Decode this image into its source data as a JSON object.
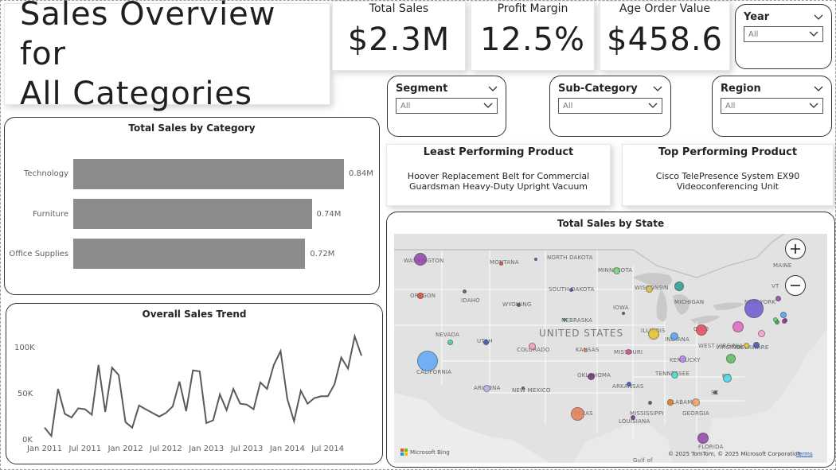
{
  "title": {
    "line1": "Sales Overview for",
    "line2": "All Categories"
  },
  "kpis": [
    {
      "label": "Total Sales",
      "value": "$2.3M"
    },
    {
      "label": "Profit Margin",
      "value": "12.5%"
    },
    {
      "label": "Age Order Value",
      "value": "$458.6"
    }
  ],
  "slicers": {
    "year": {
      "label": "Year",
      "value": "All"
    },
    "segment": {
      "label": "Segment",
      "value": "All"
    },
    "subcategory": {
      "label": "Sub-Category",
      "value": "All"
    },
    "region": {
      "label": "Region",
      "value": "All"
    }
  },
  "least_product": {
    "title": "Least Performing Product",
    "name": "Hoover Replacement Belt for Commercial Guardsman Heavy-Duty Upright Vacuum"
  },
  "top_product": {
    "title": "Top Performing Product",
    "name": "Cisco TelePresence System EX90 Videoconferencing Unit"
  },
  "category_chart": {
    "title": "Total Sales by Category",
    "bars": [
      {
        "category": "Technology",
        "label": "0.84M"
      },
      {
        "category": "Furniture",
        "label": "0.74M"
      },
      {
        "category": "Office Supplies",
        "label": "0.72M"
      }
    ]
  },
  "trend_chart": {
    "title": "Overall Sales Trend",
    "y_ticks": [
      "100K",
      "50K",
      "0K"
    ],
    "x_ticks": [
      "Jan 2011",
      "Jul 2011",
      "Jan 2012",
      "Jul 2012",
      "Jan 2013",
      "Jul 2013",
      "Jan 2014",
      "Jul 2014"
    ]
  },
  "chart_data": [
    {
      "type": "bar",
      "title": "Total Sales by Category",
      "categories": [
        "Technology",
        "Furniture",
        "Office Supplies"
      ],
      "values": [
        0.84,
        0.74,
        0.72
      ],
      "unit": "M",
      "orientation": "horizontal"
    },
    {
      "type": "line",
      "title": "Overall Sales Trend",
      "x": [
        "2011-01",
        "2011-02",
        "2011-03",
        "2011-04",
        "2011-05",
        "2011-06",
        "2011-07",
        "2011-08",
        "2011-09",
        "2011-10",
        "2011-11",
        "2011-12",
        "2012-01",
        "2012-02",
        "2012-03",
        "2012-04",
        "2012-05",
        "2012-06",
        "2012-07",
        "2012-08",
        "2012-09",
        "2012-10",
        "2012-11",
        "2012-12",
        "2013-01",
        "2013-02",
        "2013-03",
        "2013-04",
        "2013-05",
        "2013-06",
        "2013-07",
        "2013-08",
        "2013-09",
        "2013-10",
        "2013-11",
        "2013-12",
        "2014-01",
        "2014-02",
        "2014-03",
        "2014-04",
        "2014-05",
        "2014-06",
        "2014-07",
        "2014-08",
        "2014-09",
        "2014-10",
        "2014-11",
        "2014-12"
      ],
      "values": [
        14000,
        5000,
        56000,
        29000,
        25000,
        35000,
        34000,
        28000,
        82000,
        31000,
        79000,
        71000,
        20000,
        14000,
        38000,
        34000,
        30000,
        26000,
        30000,
        37000,
        64000,
        32000,
        76000,
        75000,
        19000,
        22000,
        50000,
        33000,
        56000,
        40000,
        39000,
        34000,
        63000,
        56000,
        82000,
        97000,
        45000,
        21000,
        54000,
        40000,
        46000,
        48000,
        48000,
        61000,
        90000,
        78000,
        113000,
        92000
      ],
      "ylim": [
        0,
        120000
      ],
      "y_ticks": [
        "100K",
        "50K",
        "0K"
      ],
      "x_ticks": [
        "Jan 2011",
        "Jul 2011",
        "Jan 2012",
        "Jul 2012",
        "Jan 2013",
        "Jul 2013",
        "Jan 2014",
        "Jul 2014"
      ],
      "color": "#5a5a5a"
    }
  ],
  "map": {
    "title": "Total Sales by State",
    "country_label": "UNITED STATES",
    "state_labels": [
      {
        "name": "WASHINGTON"
      },
      {
        "name": "MONTANA"
      },
      {
        "name": "NORTH DAKOTA"
      },
      {
        "name": "MINNESOTA"
      },
      {
        "name": "OREGON"
      },
      {
        "name": "IDAHO"
      },
      {
        "name": "SOUTH DAKOTA"
      },
      {
        "name": "WISCONSIN"
      },
      {
        "name": "MICHIGAN"
      },
      {
        "name": "WYOMING"
      },
      {
        "name": "IOWA"
      },
      {
        "name": "NEBRASKA"
      },
      {
        "name": "NEVADA"
      },
      {
        "name": "ILLINOIS"
      },
      {
        "name": "INDIANA"
      },
      {
        "name": "OHIO"
      },
      {
        "name": "UTAH"
      },
      {
        "name": "COLORADO"
      },
      {
        "name": "KANSAS"
      },
      {
        "name": "MISSOURI"
      },
      {
        "name": "WEST VIRGINIA"
      },
      {
        "name": "VIRGINIA"
      },
      {
        "name": "DELAWARE"
      },
      {
        "name": "KENTUCKY"
      },
      {
        "name": "CALIFORNIA"
      },
      {
        "name": "TENNESSEE"
      },
      {
        "name": "NC"
      },
      {
        "name": "OKLAHOMA"
      },
      {
        "name": "ARIZONA"
      },
      {
        "name": "NEW MEXICO"
      },
      {
        "name": "ARKANSAS"
      },
      {
        "name": "SC"
      },
      {
        "name": "ALABAMA"
      },
      {
        "name": "MISSISSIPPI"
      },
      {
        "name": "GEORGIA"
      },
      {
        "name": "TEXAS"
      },
      {
        "name": "LOUISIANA"
      },
      {
        "name": "FLORIDA"
      },
      {
        "name": "MAINE"
      },
      {
        "name": "VT"
      },
      {
        "name": "NEW YORK"
      },
      {
        "name": "Gulf of"
      }
    ],
    "bubbles": [
      {
        "state": "Washington",
        "color": "#8e44ad"
      },
      {
        "state": "Montana",
        "color": "#e74c3c"
      },
      {
        "state": "Oregon",
        "color": "#e74c3c"
      },
      {
        "state": "Idaho",
        "color": "#555555"
      },
      {
        "state": "North Dakota",
        "color": "#3f51b5"
      },
      {
        "state": "Minnesota",
        "color": "#7bd67b"
      },
      {
        "state": "South Dakota",
        "color": "#3f51b5"
      },
      {
        "state": "Wisconsin",
        "color": "#d4c043"
      },
      {
        "state": "Michigan",
        "color": "#2a9d8f"
      },
      {
        "state": "Wyoming",
        "color": "#555555"
      },
      {
        "state": "Iowa",
        "color": "#555555"
      },
      {
        "state": "Nebraska",
        "color": "#2ea043"
      },
      {
        "state": "Nevada",
        "color": "#48c9b0"
      },
      {
        "state": "Utah",
        "color": "#3f51b5"
      },
      {
        "state": "California",
        "color": "#5ea8f5"
      },
      {
        "state": "Colorado",
        "color": "#f5a0b0"
      },
      {
        "state": "Kansas",
        "color": "#f08a5d"
      },
      {
        "state": "Illinois",
        "color": "#e5c230"
      },
      {
        "state": "Indiana",
        "color": "#4fa3f5"
      },
      {
        "state": "Ohio",
        "color": "#e74c5c"
      },
      {
        "state": "Missouri",
        "color": "#e84393"
      },
      {
        "state": "Kentucky",
        "color": "#b388eb"
      },
      {
        "state": "Tennessee",
        "color": "#48dbc8"
      },
      {
        "state": "Arizona",
        "color": "#b8b5f0"
      },
      {
        "state": "New Mexico",
        "color": "#555555"
      },
      {
        "state": "Oklahoma",
        "color": "#6c3483"
      },
      {
        "state": "Arkansas",
        "color": "#3f51b5"
      },
      {
        "state": "Texas",
        "color": "#e67e5a"
      },
      {
        "state": "Louisiana",
        "color": "#6c3483"
      },
      {
        "state": "Mississippi",
        "color": "#555555"
      },
      {
        "state": "Alabama",
        "color": "#e67e22"
      },
      {
        "state": "Georgia",
        "color": "#f5a06b"
      },
      {
        "state": "Florida",
        "color": "#8e44ad"
      },
      {
        "state": "South Carolina",
        "color": "#555555"
      },
      {
        "state": "North Carolina",
        "color": "#48dbe8"
      },
      {
        "state": "Virginia",
        "color": "#5fbf5f"
      },
      {
        "state": "West Virginia",
        "color": "#e5c230"
      },
      {
        "state": "Delaware",
        "color": "#3f51b5"
      },
      {
        "state": "Pennsylvania",
        "color": "#e066c0"
      },
      {
        "state": "New York",
        "color": "#6a5acd"
      },
      {
        "state": "New Jersey",
        "color": "#f5a0c8"
      },
      {
        "state": "Connecticut",
        "color": "#4fa3f5"
      },
      {
        "state": "Massachusetts",
        "color": "#3f51b5"
      },
      {
        "state": "Rhode Island",
        "color": "#c03090"
      },
      {
        "state": "Vermont",
        "color": "#2ea043"
      },
      {
        "state": "New Hampshire",
        "color": "#8e44ad"
      },
      {
        "state": "Maryland",
        "color": "#6bd06b"
      }
    ],
    "attribution": "© 2025 TomTom, © 2025 Microsoft Corporation",
    "terms": "Terms",
    "logo": "Microsoft Bing"
  }
}
